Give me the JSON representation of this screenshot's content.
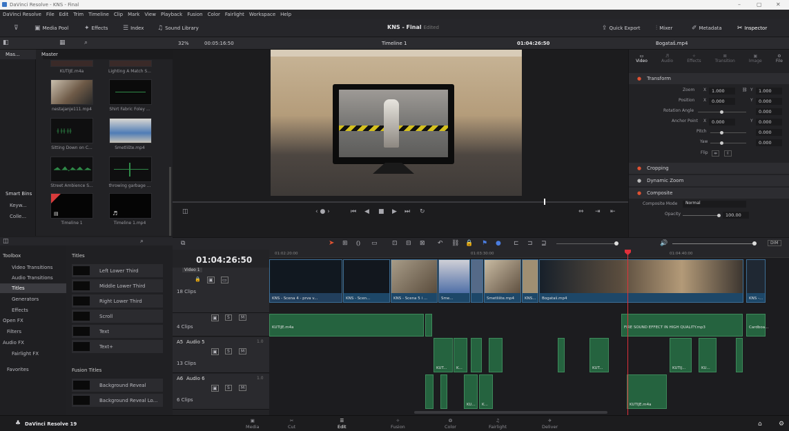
{
  "window": {
    "title": "DaVinci Resolve - KNS - Final",
    "controls": [
      "–",
      "▢",
      "✕"
    ]
  },
  "menu": [
    "DaVinci Resolve",
    "File",
    "Edit",
    "Trim",
    "Timeline",
    "Clip",
    "Mark",
    "View",
    "Playback",
    "Fusion",
    "Color",
    "Fairlight",
    "Workspace",
    "Help"
  ],
  "toolbar": {
    "media_pool": "Media Pool",
    "effects": "Effects",
    "index": "Index",
    "sound_library": "Sound Library",
    "project_title": "KNS - Final",
    "project_status": "Edited",
    "quick_export": "Quick Export",
    "mixer": "Mixer",
    "metadata": "Metadata",
    "inspector": "Inspector"
  },
  "subtool": {
    "zoom": "32%",
    "src_tc": "00:05:16:50",
    "timeline_name": "Timeline 1",
    "rec_tc": "01:04:26:50",
    "clip_name": "Bogataš.mp4"
  },
  "mediapool": {
    "bins": [
      "Mas...",
      "Master"
    ],
    "smart_bins": "Smart Bins",
    "smart_items": [
      "Keyw...",
      "Colle..."
    ],
    "clips": [
      {
        "label": "KUTIJE.m4a"
      },
      {
        "label": "Lighting A Match S..."
      },
      {
        "label": "nestajanje111.mp4"
      },
      {
        "label": "Shirt Fabric Foley ..."
      },
      {
        "label": "Sitting Down on C..."
      },
      {
        "label": "Smetlište.mp4"
      },
      {
        "label": "Street Ambience S..."
      },
      {
        "label": "throwing garbage ..."
      },
      {
        "label": "Timeline 1"
      },
      {
        "label": "Timeline 1.mp4"
      }
    ]
  },
  "toolbox": {
    "items": [
      "Toolbox",
      "Video Transitions",
      "Audio Transitions",
      "Titles",
      "Generators",
      "Effects",
      "Open FX",
      "Filters",
      "Audio FX",
      "Fairlight FX",
      "Favorites"
    ],
    "titles_header": "Titles",
    "titles": [
      "Left Lower Third",
      "Middle Lower Third",
      "Right Lower Third",
      "Scroll",
      "Text",
      "Text+"
    ],
    "fusion_header": "Fusion Titles",
    "fusion_titles": [
      "Background Reveal",
      "Background Reveal Lo..."
    ]
  },
  "inspector": {
    "tabs": [
      "Video",
      "Audio",
      "Effects",
      "Transition",
      "Image",
      "File"
    ],
    "transform": "Transform",
    "zoom_label": "Zoom",
    "zoom_x": "1.000",
    "zoom_y": "1.000",
    "position_label": "Position",
    "pos_x": "0.000",
    "pos_y": "0.000",
    "rotation_label": "Rotation Angle",
    "rotation": "0.000",
    "anchor_label": "Anchor Point",
    "anchor_x": "0.000",
    "anchor_y": "0.000",
    "pitch_label": "Pitch",
    "pitch": "0.000",
    "yaw_label": "Yaw",
    "yaw": "0.000",
    "flip_label": "Flip",
    "cropping": "Cropping",
    "dynamic_zoom": "Dynamic Zoom",
    "composite": "Composite",
    "composite_mode_label": "Composite Mode",
    "composite_mode": "Normal",
    "opacity_label": "Opacity",
    "opacity": "100.00",
    "x": "X",
    "y": "Y"
  },
  "timeline": {
    "timecode": "01:04:26:50",
    "ruler": [
      "01:02:20:00",
      "01:03:30:00",
      "01:04:40:00"
    ],
    "tracks": [
      {
        "name": "Video 1",
        "clips": "18 Clips"
      },
      {
        "name": "",
        "clips": "4 Clips"
      },
      {
        "id": "A5",
        "name": "Audio 5",
        "level": "1.0",
        "clips": "13 Clips"
      },
      {
        "id": "A6",
        "name": "Audio 6",
        "level": "1.0",
        "clips": "6 Clips"
      }
    ],
    "video_clips": [
      "KNS - Scena 4 - prva v...",
      "KNS - Scen...",
      "KNS - Scena 5 i ...",
      "Sme...",
      "Smetlište.mp4",
      "KNS...",
      "Bogataš.mp4",
      "KNS -..."
    ],
    "audio_clips": [
      "KUTIJE.m4a",
      "FIRE SOUND EFFECT IN HIGH QUALITY.mp3",
      "Cardboa...",
      "KUT...",
      "K...",
      "KUT...",
      "KUTIJ...",
      "KU...",
      "KU...",
      "K...",
      "KUTIJE.m4a"
    ],
    "dim": "DIM",
    "track_btns": [
      "S",
      "M"
    ]
  },
  "bottom": {
    "app": "DaVinci Resolve 19",
    "pages": [
      "Media",
      "Cut",
      "Edit",
      "Fusion",
      "Color",
      "Fairlight",
      "Deliver"
    ],
    "active": "Edit"
  }
}
